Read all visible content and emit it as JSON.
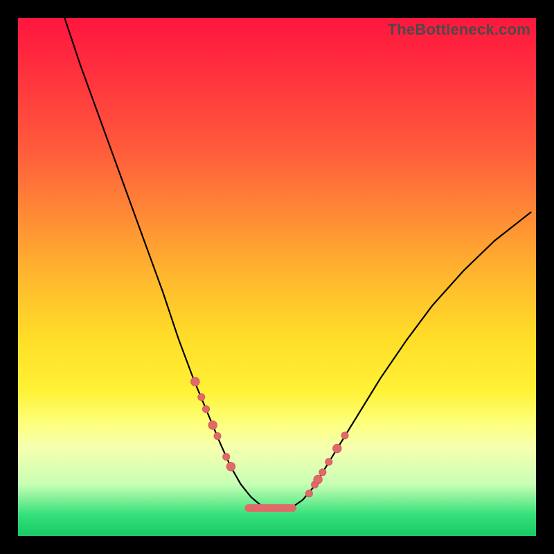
{
  "watermark": "TheBottleneck.com",
  "colors": {
    "dot": "#e06a6a",
    "curve": "#000000"
  },
  "chart_data": {
    "type": "line",
    "title": "",
    "xlabel": "",
    "ylabel": "",
    "xlim": [
      0,
      100
    ],
    "ylim": [
      0,
      100
    ],
    "grid": false,
    "legend": false,
    "note": "x and y are percentages of the plot area (0 = left/bottom, 100 = right/top). Values are visual estimates from pixel positions; the chart has no numeric tick labels.",
    "series": [
      {
        "name": "curve",
        "x": [
          9,
          12,
          16,
          20,
          24,
          28,
          31,
          34,
          36.5,
          39,
          41,
          43,
          45,
          47,
          49,
          51,
          53,
          55,
          57,
          59,
          62,
          66,
          70,
          75,
          80,
          86,
          92,
          99
        ],
        "y": [
          100,
          91,
          80,
          69,
          58,
          47,
          38,
          30,
          24,
          18,
          13.5,
          10,
          7.5,
          5.8,
          5,
          5,
          5.6,
          7,
          9.4,
          12.6,
          17.5,
          24,
          30.5,
          37.8,
          44.5,
          51.2,
          57,
          62.5
        ]
      }
    ],
    "markers": {
      "name": "highlight-dots",
      "x": [
        34.2,
        35.4,
        36.3,
        37.6,
        38.5,
        40.2,
        41.1,
        56.2,
        57.3,
        57.9,
        58.8,
        60.0,
        61.6,
        63.1
      ],
      "y": [
        29.8,
        26.8,
        24.5,
        21.4,
        19.3,
        15.3,
        13.4,
        8.2,
        9.9,
        10.9,
        12.3,
        14.3,
        16.9,
        19.4
      ]
    },
    "trough_segment": {
      "name": "trough-highlight",
      "x": [
        44.5,
        53.0
      ],
      "y": [
        5.4,
        5.4
      ]
    }
  }
}
